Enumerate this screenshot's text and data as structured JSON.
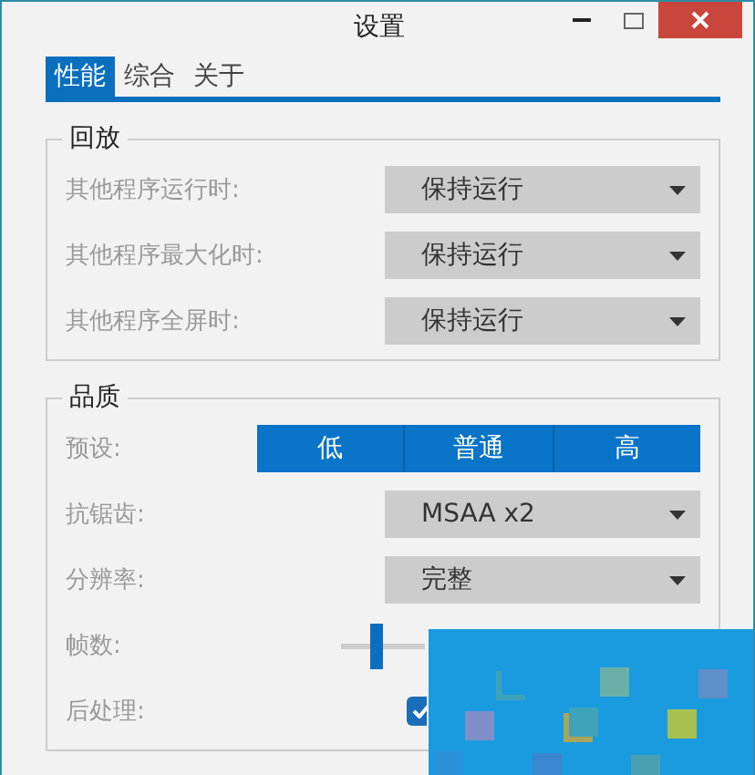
{
  "window": {
    "title": "设置"
  },
  "tabs": [
    {
      "label": "性能",
      "selected": true
    },
    {
      "label": "综合",
      "selected": false
    },
    {
      "label": "关于",
      "selected": false
    }
  ],
  "groups": [
    {
      "title": "回放",
      "rows": [
        {
          "kind": "dropdown",
          "label": "其他程序运行时:",
          "value": "保持运行"
        },
        {
          "kind": "dropdown",
          "label": "其他程序最大化时:",
          "value": "保持运行"
        },
        {
          "kind": "dropdown",
          "label": "其他程序全屏时:",
          "value": "保持运行"
        }
      ]
    },
    {
      "title": "品质",
      "rows": [
        {
          "kind": "segments",
          "label": "预设:",
          "options": [
            "低",
            "普通",
            "高"
          ]
        },
        {
          "kind": "dropdown",
          "label": "抗锯齿:",
          "value": "MSAA x2"
        },
        {
          "kind": "dropdown",
          "label": "分辨率:",
          "value": "完整"
        },
        {
          "kind": "slider",
          "label": "帧数:"
        },
        {
          "kind": "checkbox",
          "label": "后处理:",
          "checked": true
        }
      ]
    }
  ]
}
